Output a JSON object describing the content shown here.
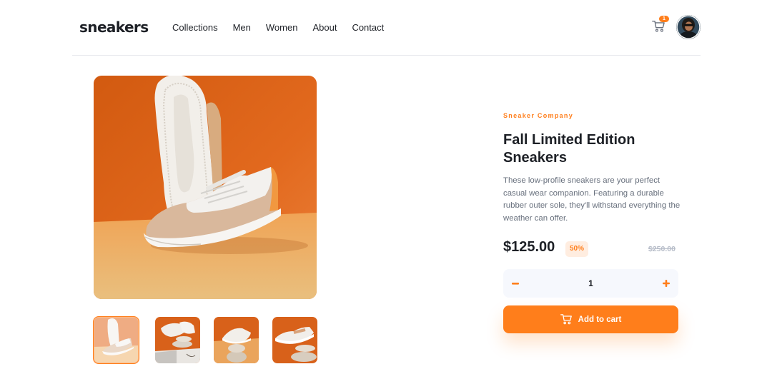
{
  "header": {
    "logo": "sneakers",
    "nav": [
      "Collections",
      "Men",
      "Women",
      "About",
      "Contact"
    ],
    "cart_count": "1"
  },
  "product": {
    "company": "Sneaker Company",
    "title": "Fall Limited Edition Sneakers",
    "description": "These low-profile sneakers are your perfect casual wear companion. Featuring a durable rubber outer sole, they'll withstand everything the weather can offer.",
    "price": "$125.00",
    "discount": "50%",
    "original_price": "$250.00",
    "quantity": "1",
    "add_to_cart_label": "Add to cart"
  },
  "gallery": {
    "selected_index": 0,
    "thumbnail_count": 4
  },
  "colors": {
    "accent": "#ff7e1b",
    "accent_pale": "#ffede0",
    "text_dark": "#1d2026",
    "text_gray": "#68707d",
    "text_light": "#b6bcc8",
    "panel": "#f6f8fd"
  },
  "icons": [
    "cart-icon",
    "avatar",
    "minus-icon",
    "plus-icon"
  ]
}
